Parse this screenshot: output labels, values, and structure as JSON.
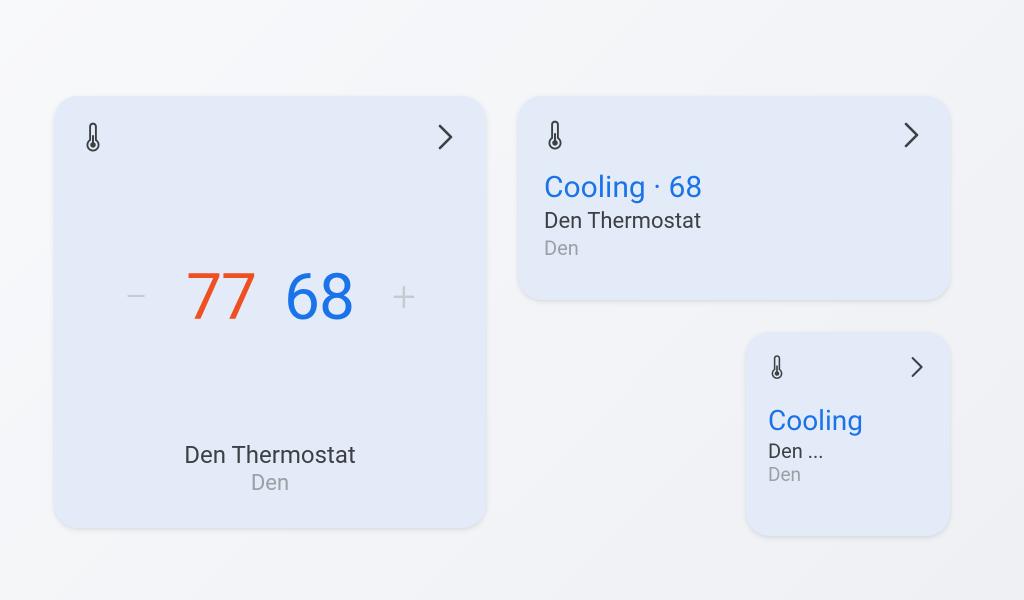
{
  "large": {
    "heat_setpoint": "77",
    "cool_setpoint": "68",
    "device": "Den Thermostat",
    "room": "Den",
    "minus": "−",
    "plus": "+"
  },
  "medium": {
    "status": "Cooling · 68",
    "device": "Den Thermostat",
    "room": "Den"
  },
  "small": {
    "status": "Cooling",
    "device": "Den ...",
    "room": "Den"
  }
}
